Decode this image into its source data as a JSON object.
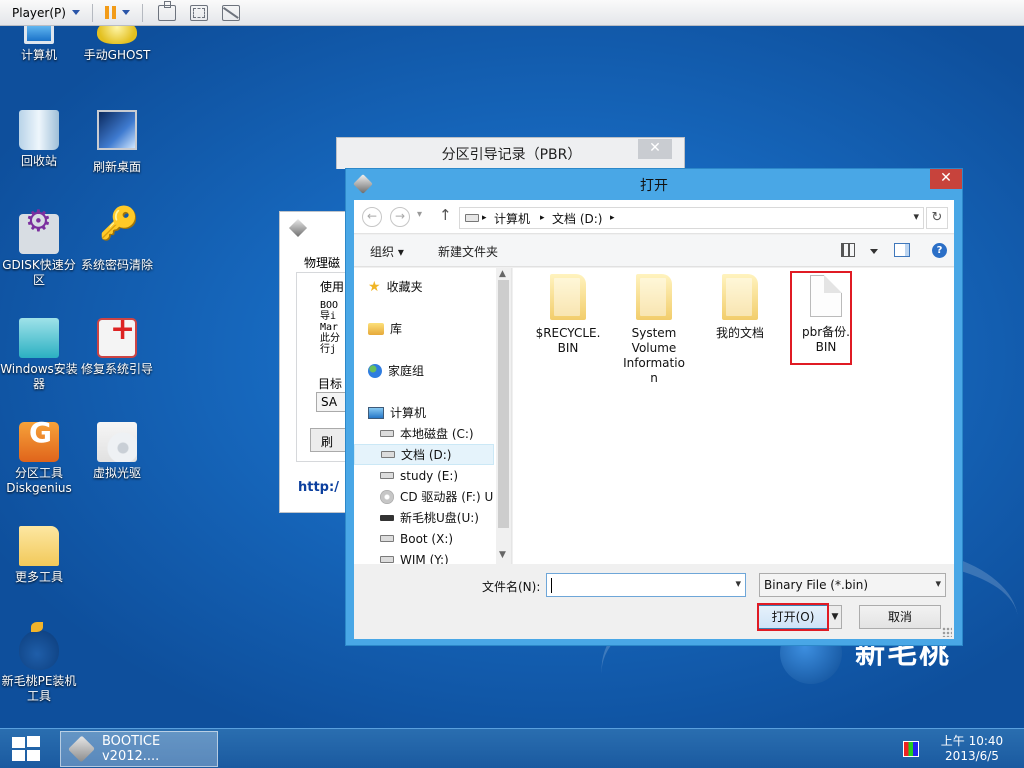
{
  "player_bar": {
    "menu_label": "Player(P)",
    "icons": [
      "pause-icon",
      "send-ctrl-alt-del-icon",
      "fullscreen-icon",
      "unity-icon"
    ]
  },
  "desktop": {
    "brand": "新毛桃",
    "icons": [
      {
        "label": "计算机",
        "icon": "computer-icon"
      },
      {
        "label": "手动GHOST",
        "icon": "ghost-icon"
      },
      {
        "label": "回收站",
        "icon": "recycle-bin-icon"
      },
      {
        "label": "刷新桌面",
        "icon": "refresh-desktop-icon"
      },
      {
        "label": "GDISK快速分区",
        "icon": "gdisk-icon"
      },
      {
        "label": "系统密码清除",
        "icon": "key-icon"
      },
      {
        "label": "Windows安装器",
        "icon": "windows-installer-icon"
      },
      {
        "label": "修复系统引导",
        "icon": "repair-boot-icon"
      },
      {
        "label": "分区工具Diskgenius",
        "icon": "diskgenius-icon"
      },
      {
        "label": "虚拟光驱",
        "icon": "virtual-drive-icon"
      },
      {
        "label": "更多工具",
        "icon": "folder-icon"
      },
      {
        "label": "新毛桃PE装机工具",
        "icon": "peach-logo-icon"
      }
    ]
  },
  "bootice_window": {
    "group_title": "物理磁",
    "use_label": "使用",
    "info_lines": [
      "BOO",
      "导i",
      "Mar",
      "此分",
      "行j"
    ],
    "target_label": "目标",
    "target_value": "SA",
    "refresh_label": "刷",
    "link": "http:/"
  },
  "pbr_dialog": {
    "title": "分区引导记录（PBR）",
    "close": "✕"
  },
  "open_dialog": {
    "title": "打开",
    "close": "✕",
    "nav": {
      "back": "←",
      "forward": "→",
      "recent": "▾",
      "up": "↑"
    },
    "breadcrumb": [
      "计算机",
      "文档 (D:)"
    ],
    "breadcrumb_sep": "▸",
    "toolbar": {
      "organize": "组织 ▾",
      "new_folder": "新建文件夹"
    },
    "nav_pane": [
      {
        "label": "收藏夹",
        "icon": "star-icon"
      },
      {
        "label": "库",
        "icon": "library-icon"
      },
      {
        "label": "家庭组",
        "icon": "homegroup-icon"
      },
      {
        "label": "计算机",
        "icon": "computer-icon"
      },
      {
        "label": "本地磁盘 (C:)",
        "icon": "drive-icon"
      },
      {
        "label": "文档 (D:)",
        "icon": "drive-icon"
      },
      {
        "label": "study (E:)",
        "icon": "drive-icon"
      },
      {
        "label": "CD 驱动器 (F:) U",
        "icon": "cd-drive-icon"
      },
      {
        "label": "新毛桃U盘(U:)",
        "icon": "usb-drive-icon"
      },
      {
        "label": "Boot (X:)",
        "icon": "drive-icon"
      },
      {
        "label": "WIM (Y:)",
        "icon": "drive-icon"
      }
    ],
    "files": [
      {
        "label": "$RECYCLE.\nBIN",
        "type": "folder"
      },
      {
        "label": "System\nVolume\nInformatio\nn",
        "type": "folder"
      },
      {
        "label": "我的文档",
        "type": "folder"
      },
      {
        "label": "pbr备份.\nBIN",
        "type": "file"
      }
    ],
    "filename_label": "文件名(N):",
    "filename_value": "",
    "filetype_value": "Binary File (*.bin)",
    "open_button": "打开(O)",
    "cancel_button": "取消"
  },
  "taskbar": {
    "task_label": "BOOTICE v2012....",
    "time": "上午 10:40",
    "date": "2013/6/5"
  },
  "colors": {
    "desktop_blue": "#1769bf",
    "dialog_frame": "#49a7e6",
    "close_red": "#c7433c",
    "highlight_red": "#e01b24"
  }
}
